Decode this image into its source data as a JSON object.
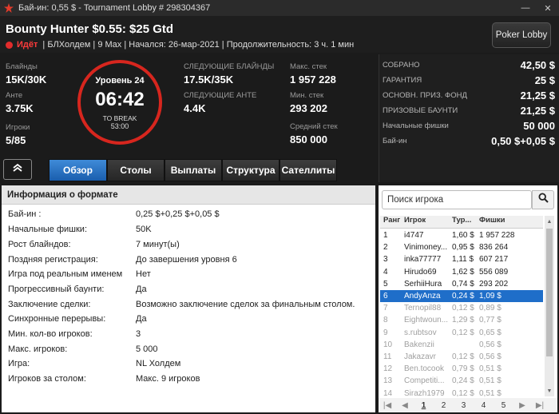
{
  "window": {
    "title": "Бай-ин: 0,55 $ - Tournament Lobby # 298304367",
    "minimize": "—",
    "close": "✕"
  },
  "header": {
    "tournament_name": "Bounty Hunter $0.55: $25 Gtd",
    "status": "Идёт",
    "details": "| БЛХолдем | 9 Max | Начался: 26-мар-2021 | Продолжительность: 3 ч. 1 мин",
    "poker_lobby_label": "Poker Lobby"
  },
  "stats": {
    "blinds_label": "Блайнды",
    "blinds": "15K/30K",
    "ante_label": "Анте",
    "ante": "3.75K",
    "players_label": "Игроки",
    "players": "5/85",
    "next_blinds_label": "СЛЕДУЮЩИЕ БЛАЙНДЫ",
    "next_blinds": "17.5K/35K",
    "next_ante_label": "СЛЕДУЮЩИЕ АНТЕ",
    "next_ante": "4.4K",
    "max_stack_label": "Макс. стек",
    "max_stack": "1 957 228",
    "min_stack_label": "Мин. стек",
    "min_stack": "293 202",
    "avg_stack_label": "Средний стек",
    "avg_stack": "850 000"
  },
  "clock": {
    "level": "Уровень 24",
    "time": "06:42",
    "break_label": "TO BREAK",
    "break_time": "53:00"
  },
  "prizes": [
    {
      "label": "СОБРАНО",
      "value": "42,50 $"
    },
    {
      "label": "ГАРАНТИЯ",
      "value": "25 $"
    },
    {
      "label": "ОСНОВН. ПРИЗ. ФОНД",
      "value": "21,25 $"
    },
    {
      "label": "ПРИЗОВЫЕ БАУНТИ",
      "value": "21,25 $"
    },
    {
      "label": "Начальные фишки",
      "value": "50 000"
    },
    {
      "label": "Бай-ин",
      "value": "0,50 $+0,05 $"
    }
  ],
  "tabs": [
    {
      "label": "Обзор",
      "active": true
    },
    {
      "label": "Столы",
      "active": false
    },
    {
      "label": "Выплаты",
      "active": false
    },
    {
      "label": "Структура",
      "active": false
    },
    {
      "label": "Сателлиты",
      "active": false
    }
  ],
  "format": {
    "heading": "Информация о формате",
    "rows": [
      {
        "k": "Бай-ин :",
        "v": "0,25 $+0,25 $+0,05 $"
      },
      {
        "k": "Начальные фишки:",
        "v": "50K"
      },
      {
        "k": "Рост блайндов:",
        "v": "7 минут(ы)"
      },
      {
        "k": "Поздняя регистрация:",
        "v": "До завершения уровня 6"
      },
      {
        "k": "Игра под реальным именем",
        "v": "Нет"
      },
      {
        "k": "Прогрессивный баунти:",
        "v": "Да"
      },
      {
        "k": "Заключение сделки:",
        "v": "Возможно заключение сделок за финальным столом."
      },
      {
        "k": "Синхронные перерывы:",
        "v": "Да"
      },
      {
        "k": "Мин. кол-во игроков:",
        "v": "3"
      },
      {
        "k": "Макс. игроков:",
        "v": "5 000"
      },
      {
        "k": "Игра:",
        "v": "NL Холдем"
      },
      {
        "k": "Игроков за столом:",
        "v": "Макс. 9 игроков"
      }
    ]
  },
  "players": {
    "search_placeholder": "Поиск игрока",
    "columns": [
      "Ранг",
      "Игрок",
      "Тур...",
      "Фишки"
    ],
    "rows": [
      {
        "rank": "1",
        "name": "i4747",
        "bounty": "1,60 $",
        "chips": "1 957 228",
        "state": "normal"
      },
      {
        "rank": "2",
        "name": "Vinimoney...",
        "bounty": "0,95 $",
        "chips": "836 264",
        "state": "normal"
      },
      {
        "rank": "3",
        "name": "inka77777",
        "bounty": "1,11 $",
        "chips": "607 217",
        "state": "normal"
      },
      {
        "rank": "4",
        "name": "Hirudo69",
        "bounty": "1,62 $",
        "chips": "556 089",
        "state": "normal"
      },
      {
        "rank": "5",
        "name": "SerhiiHura",
        "bounty": "0,74 $",
        "chips": "293 202",
        "state": "normal"
      },
      {
        "rank": "6",
        "name": "AndyAnza",
        "bounty": "0,24 $",
        "chips": "1,09 $",
        "state": "selected"
      },
      {
        "rank": "7",
        "name": "Ternopil88",
        "bounty": "0,12 $",
        "chips": "0,89 $",
        "state": "dim"
      },
      {
        "rank": "8",
        "name": "Eightwoun...",
        "bounty": "1,29 $",
        "chips": "0,77 $",
        "state": "dim"
      },
      {
        "rank": "9",
        "name": "s.rubtsov",
        "bounty": "0,12 $",
        "chips": "0,65 $",
        "state": "dim"
      },
      {
        "rank": "10",
        "name": "Bakenzii",
        "bounty": "",
        "chips": "0,56 $",
        "state": "dim"
      },
      {
        "rank": "11",
        "name": "Jakazavr",
        "bounty": "0,12 $",
        "chips": "0,56 $",
        "state": "dim"
      },
      {
        "rank": "12",
        "name": "Ben.tocook",
        "bounty": "0,79 $",
        "chips": "0,51 $",
        "state": "dim"
      },
      {
        "rank": "13",
        "name": "Competiti...",
        "bounty": "0,24 $",
        "chips": "0,51 $",
        "state": "dim"
      },
      {
        "rank": "14",
        "name": "Sirazh1979",
        "bounty": "0,12 $",
        "chips": "0,51 $",
        "state": "dim"
      }
    ],
    "pager": {
      "first": "|◀",
      "prev": "◀",
      "pages": [
        "1",
        "2",
        "3",
        "4",
        "5"
      ],
      "current": "1",
      "next": "▶",
      "last": "▶|"
    }
  },
  "colors": {
    "accent_blue": "#1f6ec9",
    "clock_red": "#d7261e",
    "status_red": "#ff3b3b"
  }
}
